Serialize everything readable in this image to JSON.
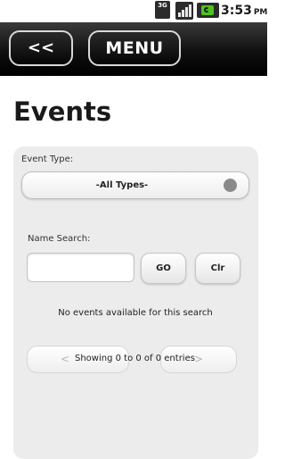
{
  "status_bar": {
    "network_label": "3G",
    "network_icon": "3g-data-icon",
    "signal_icon": "signal-strength-icon",
    "battery_icon": "battery-charging-icon",
    "time": "3:53",
    "ampm": "PM"
  },
  "toolbar": {
    "back_label": "<<",
    "menu_label": "MENU"
  },
  "page": {
    "title": "Events"
  },
  "filters": {
    "event_type_label": "Event Type:",
    "event_type_value": "-All Types-",
    "name_search_label": "Name Search:",
    "name_search_value": "",
    "go_label": "GO",
    "clear_label": "Clr"
  },
  "results": {
    "empty_message": "No events available for this search",
    "pager_info": "Showing 0 to 0 of 0 entries",
    "prev_icon": "chevron-left-icon",
    "next_icon": "chevron-right-icon"
  },
  "colors": {
    "toolbar_bg": "#000000",
    "panel_bg": "#ececec",
    "battery_accent": "#4ec31f"
  }
}
